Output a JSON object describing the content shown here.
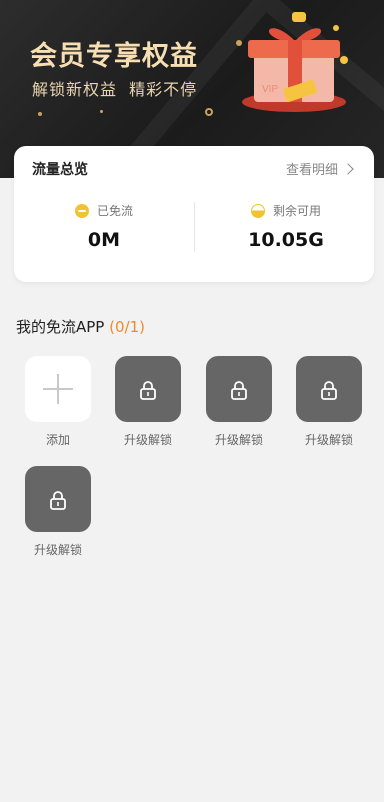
{
  "banner": {
    "title": "会员专享权益",
    "subtitle": "解锁新权益  精彩不停",
    "gift_text": "VIP"
  },
  "overview": {
    "title": "流量总览",
    "link_label": "查看明细",
    "free_label": "已免流",
    "free_value": "0M",
    "remaining_label": "剩余可用",
    "remaining_value": "10.05G"
  },
  "apps_section": {
    "title": "我的免流APP",
    "count": "(0/1)",
    "items": [
      {
        "label": "添加",
        "icon": "plus-icon"
      },
      {
        "label": "升级解锁",
        "icon": "lock-icon"
      },
      {
        "label": "升级解锁",
        "icon": "lock-icon"
      },
      {
        "label": "升级解锁",
        "icon": "lock-icon"
      },
      {
        "label": "升级解锁",
        "icon": "lock-icon"
      }
    ]
  },
  "colors": {
    "accent_orange": "#f08a2c",
    "coin_yellow": "#f2c232",
    "locked_tile": "#666666",
    "banner_gold": "#f7dfb3"
  }
}
